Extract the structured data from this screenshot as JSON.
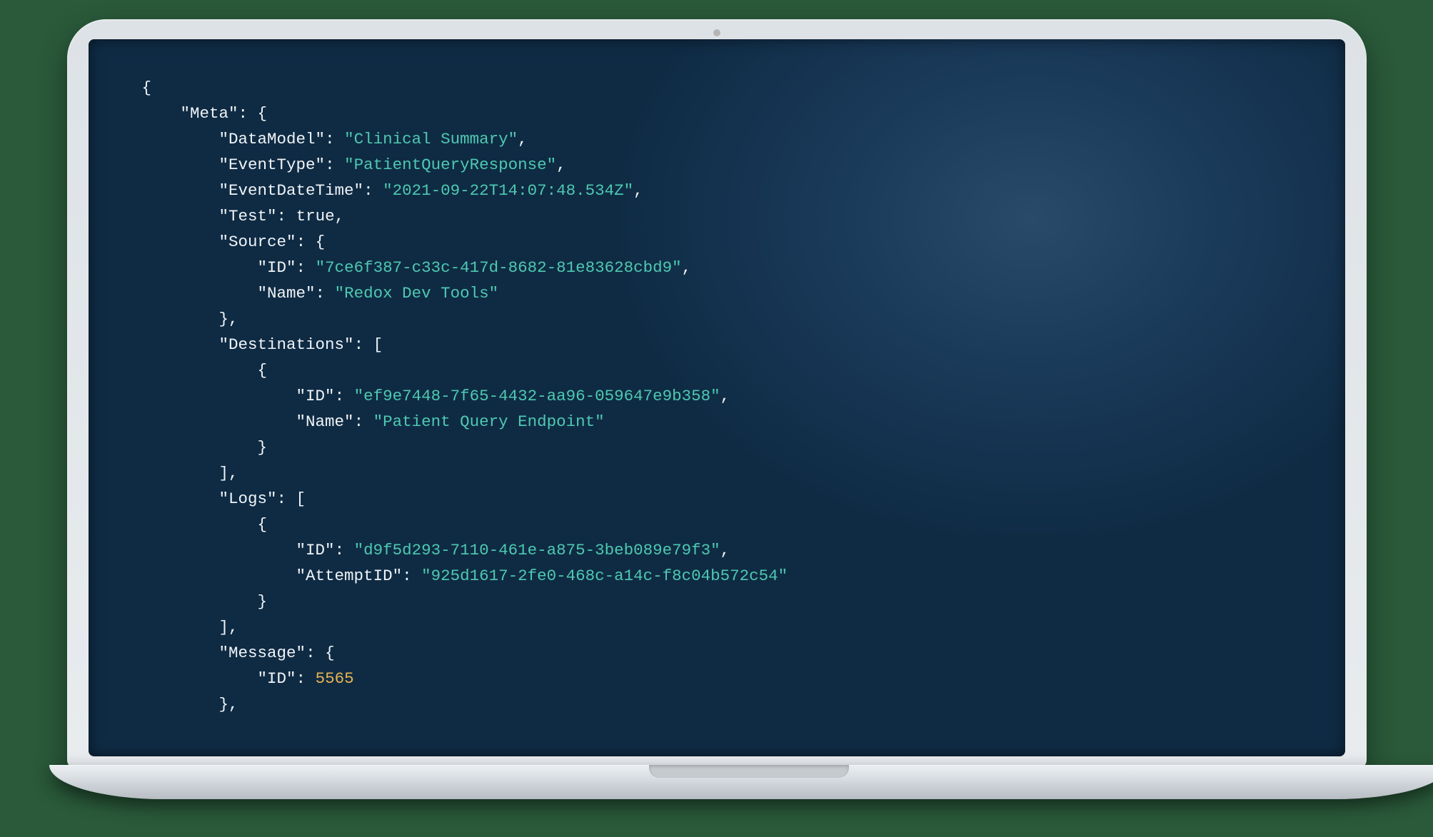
{
  "code": {
    "json_payload": {
      "Meta": {
        "DataModel": "Clinical Summary",
        "EventType": "PatientQueryResponse",
        "EventDateTime": "2021-09-22T14:07:48.534Z",
        "Test": true,
        "Source": {
          "ID": "7ce6f387-c33c-417d-8682-81e83628cbd9",
          "Name": "Redox Dev Tools"
        },
        "Destinations": [
          {
            "ID": "ef9e7448-7f65-4432-aa96-059647e9b358",
            "Name": "Patient Query Endpoint"
          }
        ],
        "Logs": [
          {
            "ID": "d9f5d293-7110-461e-a875-3beb089e79f3",
            "AttemptID": "925d1617-2fe0-468c-a14c-f8c04b572c54"
          }
        ],
        "Message": {
          "ID": 5565
        }
      }
    },
    "tokens": [
      {
        "t": "{",
        "c": "pun",
        "nl": true,
        "ind": 0
      },
      {
        "t": "\"Meta\"",
        "c": "key",
        "ind": 1
      },
      {
        "t": ": {",
        "c": "pun",
        "nl": true
      },
      {
        "t": "\"DataModel\"",
        "c": "key",
        "ind": 2
      },
      {
        "t": ": ",
        "c": "pun"
      },
      {
        "t": "\"Clinical Summary\"",
        "c": "str"
      },
      {
        "t": ",",
        "c": "pun",
        "nl": true
      },
      {
        "t": "\"EventType\"",
        "c": "key",
        "ind": 2
      },
      {
        "t": ": ",
        "c": "pun"
      },
      {
        "t": "\"PatientQueryResponse\"",
        "c": "str"
      },
      {
        "t": ",",
        "c": "pun",
        "nl": true
      },
      {
        "t": "\"EventDateTime\"",
        "c": "key",
        "ind": 2
      },
      {
        "t": ": ",
        "c": "pun"
      },
      {
        "t": "\"2021-09-22T14:07:48.534Z\"",
        "c": "str"
      },
      {
        "t": ",",
        "c": "pun",
        "nl": true
      },
      {
        "t": "\"Test\"",
        "c": "key",
        "ind": 2
      },
      {
        "t": ": ",
        "c": "pun"
      },
      {
        "t": "true",
        "c": "kw"
      },
      {
        "t": ",",
        "c": "pun",
        "nl": true
      },
      {
        "t": "\"Source\"",
        "c": "key",
        "ind": 2
      },
      {
        "t": ": {",
        "c": "pun",
        "nl": true
      },
      {
        "t": "\"ID\"",
        "c": "key",
        "ind": 3
      },
      {
        "t": ": ",
        "c": "pun"
      },
      {
        "t": "\"7ce6f387-c33c-417d-8682-81e83628cbd9\"",
        "c": "str"
      },
      {
        "t": ",",
        "c": "pun",
        "nl": true
      },
      {
        "t": "\"Name\"",
        "c": "key",
        "ind": 3
      },
      {
        "t": ": ",
        "c": "pun"
      },
      {
        "t": "\"Redox Dev Tools\"",
        "c": "str",
        "nl": true
      },
      {
        "t": "},",
        "c": "pun",
        "ind": 2,
        "nl": true
      },
      {
        "t": "\"Destinations\"",
        "c": "key",
        "ind": 2
      },
      {
        "t": ": [",
        "c": "pun",
        "nl": true
      },
      {
        "t": "{",
        "c": "pun",
        "ind": 3,
        "nl": true
      },
      {
        "t": "\"ID\"",
        "c": "key",
        "ind": 4
      },
      {
        "t": ": ",
        "c": "pun"
      },
      {
        "t": "\"ef9e7448-7f65-4432-aa96-059647e9b358\"",
        "c": "str"
      },
      {
        "t": ",",
        "c": "pun",
        "nl": true
      },
      {
        "t": "\"Name\"",
        "c": "key",
        "ind": 4
      },
      {
        "t": ": ",
        "c": "pun"
      },
      {
        "t": "\"Patient Query Endpoint\"",
        "c": "str",
        "nl": true
      },
      {
        "t": "}",
        "c": "pun",
        "ind": 3,
        "nl": true
      },
      {
        "t": "],",
        "c": "pun",
        "ind": 2,
        "nl": true
      },
      {
        "t": "\"Logs\"",
        "c": "key",
        "ind": 2
      },
      {
        "t": ": [",
        "c": "pun",
        "nl": true
      },
      {
        "t": "{",
        "c": "pun",
        "ind": 3,
        "nl": true
      },
      {
        "t": "\"ID\"",
        "c": "key",
        "ind": 4
      },
      {
        "t": ": ",
        "c": "pun"
      },
      {
        "t": "\"d9f5d293-7110-461e-a875-3beb089e79f3\"",
        "c": "str"
      },
      {
        "t": ",",
        "c": "pun",
        "nl": true
      },
      {
        "t": "\"AttemptID\"",
        "c": "key",
        "ind": 4
      },
      {
        "t": ": ",
        "c": "pun"
      },
      {
        "t": "\"925d1617-2fe0-468c-a14c-f8c04b572c54\"",
        "c": "str",
        "nl": true
      },
      {
        "t": "}",
        "c": "pun",
        "ind": 3,
        "nl": true
      },
      {
        "t": "],",
        "c": "pun",
        "ind": 2,
        "nl": true
      },
      {
        "t": "\"Message\"",
        "c": "key",
        "ind": 2
      },
      {
        "t": ": {",
        "c": "pun",
        "nl": true
      },
      {
        "t": "\"ID\"",
        "c": "key",
        "ind": 3
      },
      {
        "t": ": ",
        "c": "pun"
      },
      {
        "t": "5565",
        "c": "num",
        "nl": true
      },
      {
        "t": "},",
        "c": "pun",
        "ind": 2,
        "nl": true
      }
    ],
    "indent_unit": "    "
  }
}
